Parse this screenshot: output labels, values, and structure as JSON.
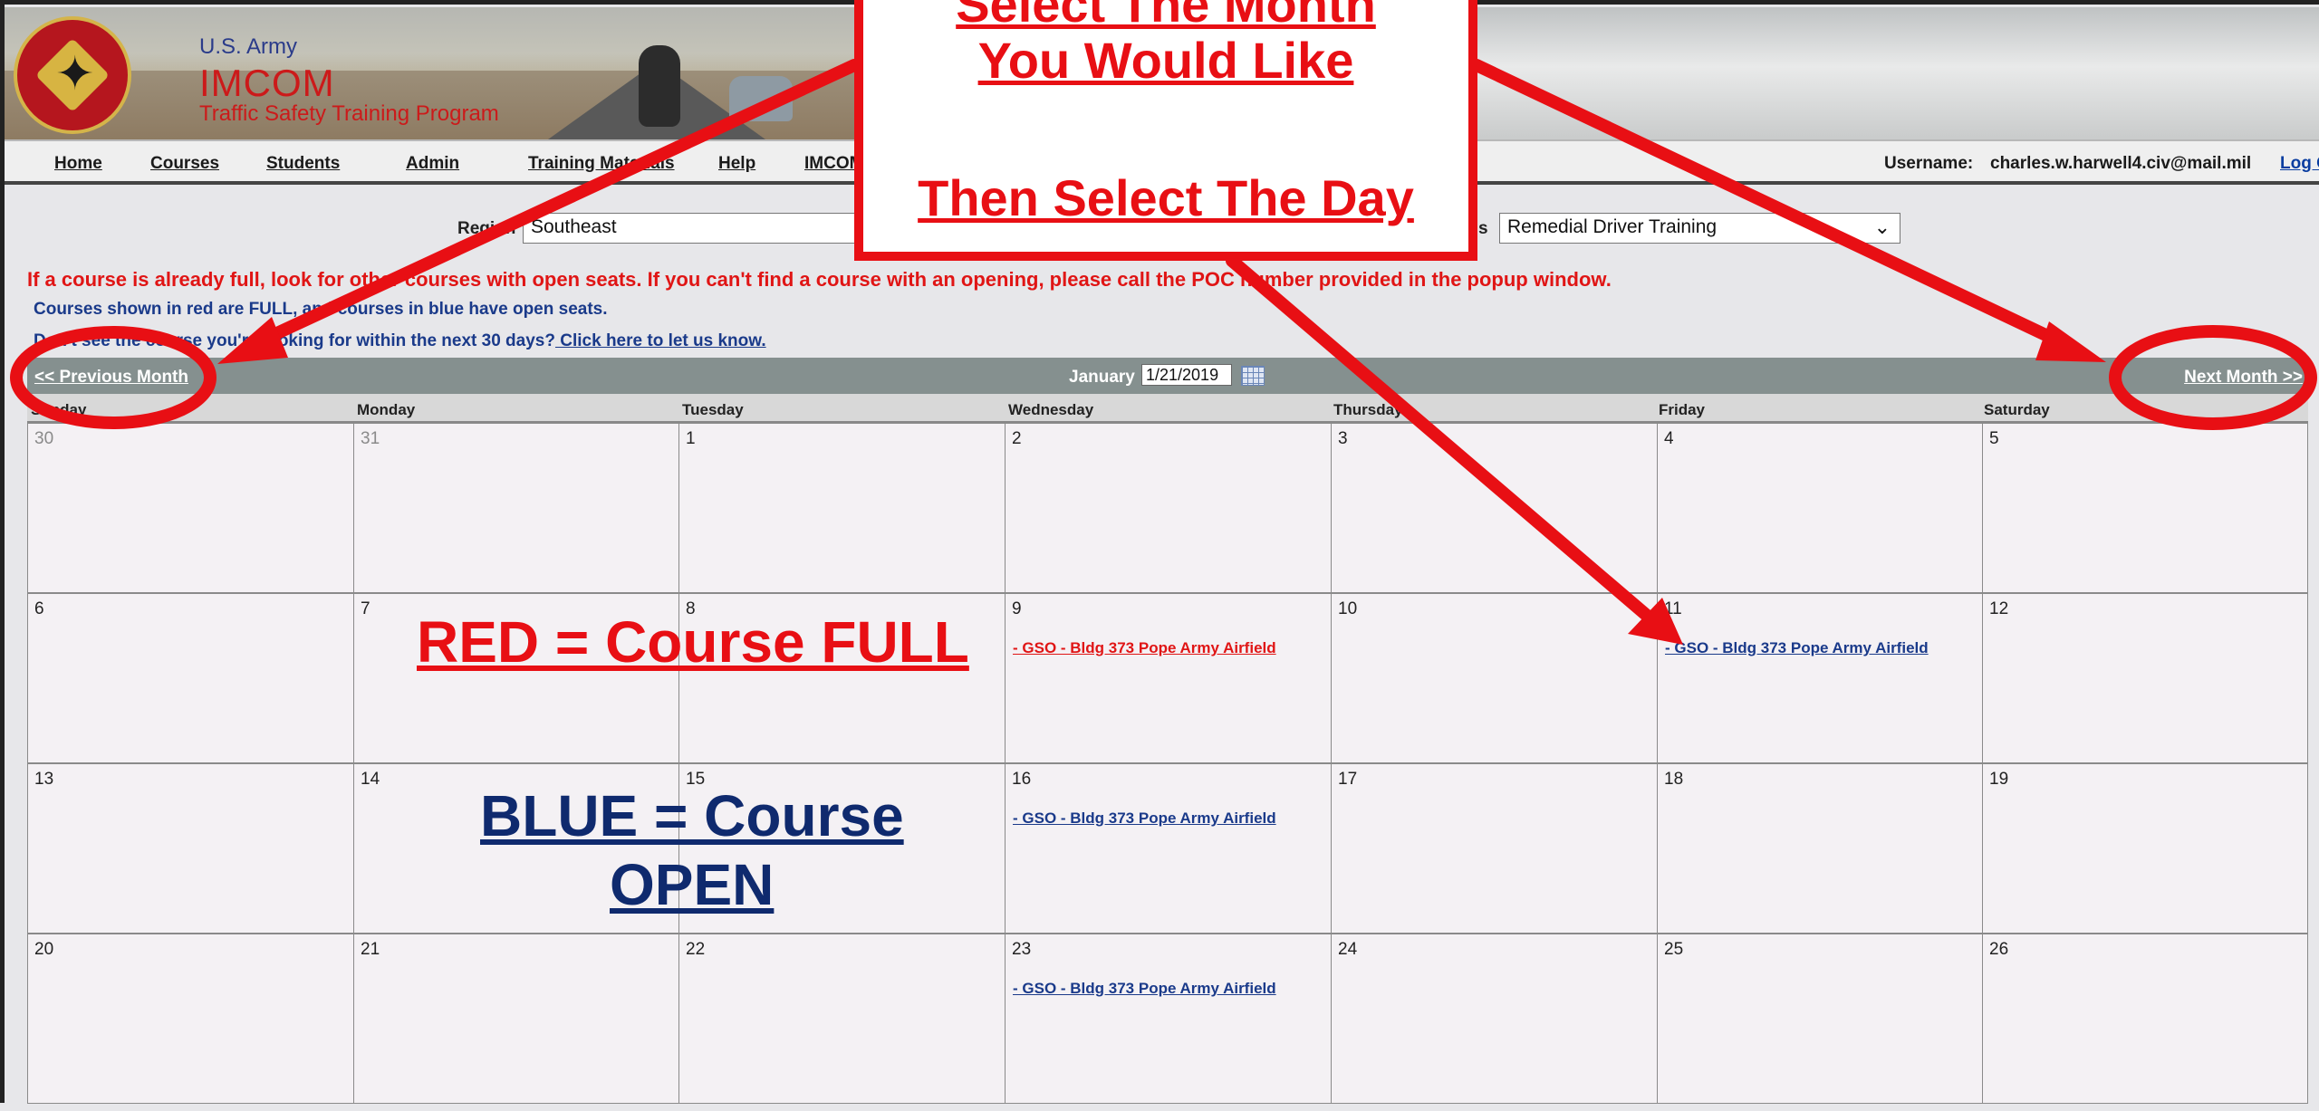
{
  "header": {
    "org": "U.S. Army",
    "name": "IMCOM",
    "program": "Traffic Safety Training Program"
  },
  "nav": {
    "items": [
      "Home",
      "Courses",
      "Students",
      "Admin",
      "Training Materials",
      "Help",
      "IMCOM"
    ],
    "username_label": "Username:",
    "username_value": "charles.w.harwell4.civ@mail.mil",
    "logout": "Log O"
  },
  "filters": {
    "region_label": "Region",
    "region_value": "Southeast",
    "courses_label": "s",
    "courses_value": "Remedial Driver Training"
  },
  "messages": {
    "full_notice": "If a course is already full, look for other courses with open seats. If you can't find a course with an opening, please call the POC number provided in the popup window.",
    "legend_notice": "Courses shown in red are FULL, and courses in blue have open seats.",
    "missing_notice": "Don't see the course you're looking for within the next 30 days?",
    "missing_link": " Click here to let us know."
  },
  "calendar": {
    "prev_label": "<< Previous Month",
    "next_label": "Next Month >>",
    "month_label": "January",
    "date_value": "1/21/2019",
    "days_of_week": [
      "Sunday",
      "Monday",
      "Tuesday",
      "Wednesday",
      "Thursday",
      "Friday",
      "Saturday"
    ],
    "weeks": [
      [
        {
          "d": "30",
          "other": true
        },
        {
          "d": "31",
          "other": true
        },
        {
          "d": "1"
        },
        {
          "d": "2"
        },
        {
          "d": "3"
        },
        {
          "d": "4"
        },
        {
          "d": "5"
        }
      ],
      [
        {
          "d": "6"
        },
        {
          "d": "7"
        },
        {
          "d": "8"
        },
        {
          "d": "9",
          "course": "- GSO - Bldg 373 Pope Army Airfield",
          "status": "full"
        },
        {
          "d": "10"
        },
        {
          "d": "11",
          "course": "- GSO - Bldg 373 Pope Army Airfield",
          "status": "open"
        },
        {
          "d": "12"
        }
      ],
      [
        {
          "d": "13"
        },
        {
          "d": "14"
        },
        {
          "d": "15"
        },
        {
          "d": "16",
          "course": "- GSO - Bldg 373 Pope Army Airfield",
          "status": "open"
        },
        {
          "d": "17"
        },
        {
          "d": "18"
        },
        {
          "d": "19"
        }
      ],
      [
        {
          "d": "20"
        },
        {
          "d": "21"
        },
        {
          "d": "22"
        },
        {
          "d": "23",
          "course": "- GSO - Bldg 373 Pope Army Airfield",
          "status": "open"
        },
        {
          "d": "24"
        },
        {
          "d": "25"
        },
        {
          "d": "26"
        }
      ]
    ]
  },
  "overlays": {
    "callout_lines": [
      "Select The Month",
      "You Would Like",
      "Then Select The Day"
    ],
    "red_legend": "RED = Course FULL",
    "blue_legend_line1": "BLUE = Course",
    "blue_legend_line2": "OPEN",
    "accent_red": "#e80f14",
    "accent_blue": "#0f2a6e"
  }
}
